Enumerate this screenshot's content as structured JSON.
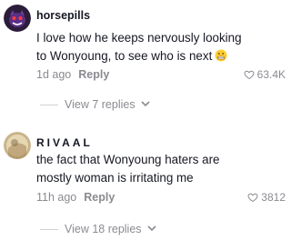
{
  "comments": [
    {
      "username": "horsepills",
      "text": "I love how he keeps nervously looking to Wonyoung, to see who is next",
      "emoji": "grimacing-face-emoji",
      "time": "1d ago",
      "reply_label": "Reply",
      "likes": "63.4K",
      "view_replies": "View 7 replies"
    },
    {
      "username": "RIVAAL",
      "text": "the fact that Wonyoung haters are mostly woman is irritating me",
      "time": "11h ago",
      "reply_label": "Reply",
      "likes": "3812",
      "view_replies": "View 18 replies"
    }
  ],
  "icons": {
    "like": "heart-outline-icon",
    "expand": "chevron-down-icon"
  },
  "colors": {
    "text": "#161823",
    "muted": "#8a8b91",
    "background": "#ffffff"
  }
}
